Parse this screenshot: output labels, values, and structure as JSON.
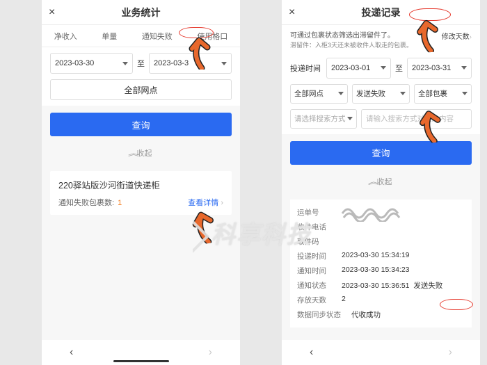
{
  "left": {
    "header": {
      "title": "业务统计",
      "close": "×"
    },
    "tabs": [
      "净收入",
      "单量",
      "通知失败",
      "使用格口"
    ],
    "date": {
      "from": "2023-03-30",
      "sep": "至",
      "to": "2023-03-3"
    },
    "all_sites": "全部网点",
    "query": "查询",
    "fold": "收起",
    "card": {
      "title": "220驿站版沙河街道快递柜",
      "fail_label": "通知失败包裹数:",
      "fail_count": "1",
      "detail": "查看详情"
    },
    "bottom": {
      "prev": "‹",
      "next": "›"
    }
  },
  "right": {
    "header": {
      "title": "投递记录",
      "close": "×"
    },
    "tip": {
      "line1": "可通过包裹状态筛选出滞留件了。",
      "line2": "滞留件：入柜3天还未被收件人取走的包裹。",
      "action": "修改天数"
    },
    "date": {
      "label": "投递时间",
      "from": "2023-03-01",
      "sep": "至",
      "to": "2023-03-31"
    },
    "filters": {
      "site": "全部网点",
      "status": "发送失败",
      "pkg": "全部包裹",
      "search_mode": "请选择搜索方式",
      "search_ph": "请输入搜索方式对应的内容"
    },
    "query": "查询",
    "fold": "收起",
    "detail": {
      "tracking_label": "运单号",
      "phone_label": "收件电话",
      "code_label": "取件码",
      "deliver_label": "投递时间",
      "deliver_val": "2023-03-30 15:34:19",
      "notify_time_label": "通知时间",
      "notify_time_val": "2023-03-30 15:34:23",
      "notify_status_label": "通知状态",
      "notify_status_time": "2023-03-30 15:36:51",
      "notify_status_val": "发送失败",
      "days_label": "存放天数",
      "days_val": "2",
      "sync_label": "数据同步状态",
      "sync_val": "代收成功"
    },
    "bottom": {
      "prev": "‹",
      "next": "›"
    }
  },
  "watermark": "科享科技"
}
